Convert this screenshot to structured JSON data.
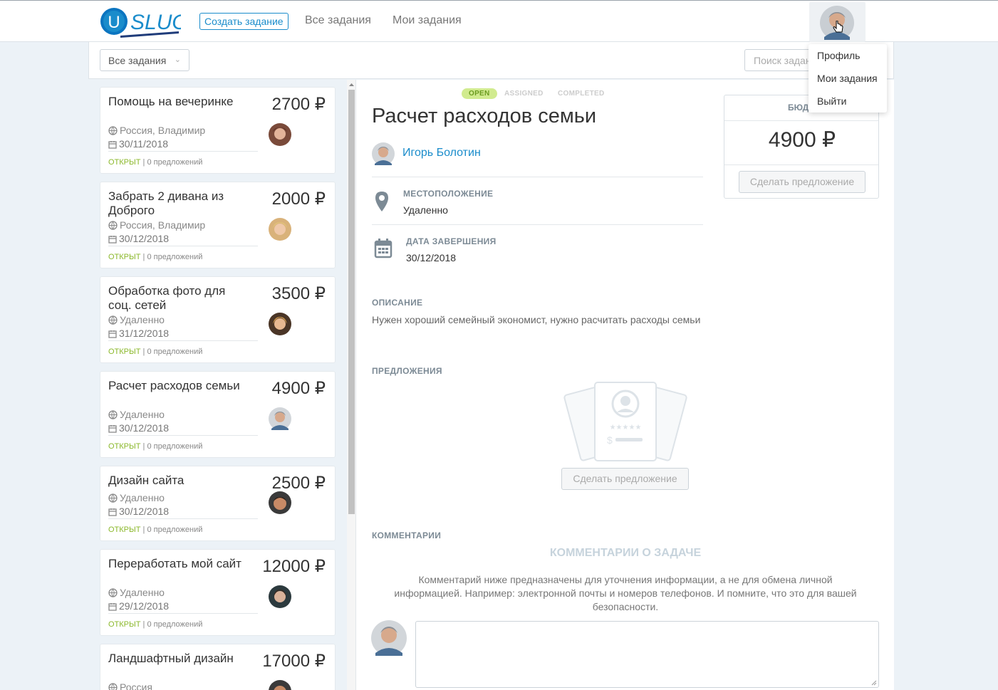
{
  "header": {
    "logo_letter": "U",
    "logo_text": "SLUG",
    "create_task": "Создать задание",
    "nav_all_tasks": "Все задания",
    "nav_my_tasks": "Мои задания"
  },
  "user_menu": {
    "items": [
      "Профиль",
      "Мои задания",
      "Выйти"
    ]
  },
  "toolbar": {
    "filter_value": "Все задания",
    "search_placeholder": "Поиск задан"
  },
  "tasks": [
    {
      "title": "Помощь на вечеринке",
      "price": "2700 ₽",
      "location": "Россия, Владимир",
      "date": "30/11/2018",
      "status": "ОТКРЫТ",
      "offers": " | 0 предложений"
    },
    {
      "title": "Забрать 2 дивана из Доброго",
      "price": "2000 ₽",
      "location": "Россия, Владимир",
      "date": "30/12/2018",
      "status": "ОТКРЫТ",
      "offers": " | 0 предложений"
    },
    {
      "title": "Обработка фото для соц. сетей",
      "price": "3500 ₽",
      "location": "Удаленно",
      "date": "31/12/2018",
      "status": "ОТКРЫТ",
      "offers": " | 0 предложений"
    },
    {
      "title": "Расчет расходов семьи",
      "price": "4900 ₽",
      "location": "Удаленно",
      "date": "30/12/2018",
      "status": "ОТКРЫТ",
      "offers": " | 0 предложений"
    },
    {
      "title": "Дизайн сайта",
      "price": "2500 ₽",
      "location": "Удаленно",
      "date": "30/12/2018",
      "status": "ОТКРЫТ",
      "offers": " | 0 предложений"
    },
    {
      "title": "Переработать мой сайт",
      "price": "12000 ₽",
      "location": "Удаленно",
      "date": "29/12/2018",
      "status": "ОТКРЫТ",
      "offers": " | 0 предложений"
    },
    {
      "title": "Ландшафтный дизайн",
      "price": "17000 ₽",
      "location": "Россия",
      "date": "",
      "status": "",
      "offers": ""
    }
  ],
  "detail": {
    "status_steps": [
      "OPEN",
      "ASSIGNED",
      "COMPLETED"
    ],
    "title": "Расчет расходов семьи",
    "author": "Игорь Болотин",
    "location_label": "МЕСТОПОЛОЖЕНИЕ",
    "location_value": "Удаленно",
    "due_label": "ДАТА ЗАВЕРШЕНИЯ",
    "due_value": "30/12/2018",
    "description_label": "ОПИСАНИЕ",
    "description_text": "Нужен хороший семейный экономист, нужно расчитать расходы семьи",
    "offers_label": "ПРЕДЛОЖЕНИЯ",
    "make_offer": "Сделать предложение",
    "comments_label": "КОММЕНТАРИИ",
    "comments_heading": "КОММЕНТАРИИ О ЗАДАЧЕ",
    "comments_note": "Комментарий ниже предназначены для уточнения информации, а не для обмена личной информацией. Например: электронной почты и номеров телефонов. И помните, что это для вашей безопасности."
  },
  "budget": {
    "label": "БЮДЖ",
    "amount": "4900 ₽",
    "make_offer": "Сделать предложение"
  },
  "colors": {
    "accent": "#1a8ccb",
    "open_status": "#8bb82b",
    "open_badge_bg": "#d1eb8f"
  }
}
